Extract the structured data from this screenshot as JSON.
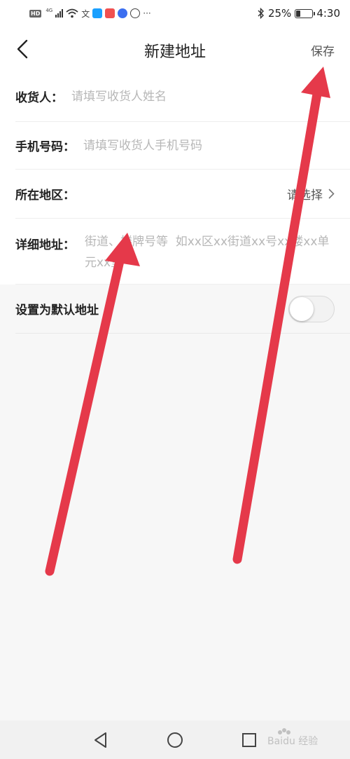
{
  "status_bar": {
    "hd": "HD",
    "network": "4G",
    "battery_text": "25%",
    "battery_level": 0.25,
    "time": "4:30",
    "overflow": "···"
  },
  "header": {
    "title": "新建地址",
    "save_label": "保存"
  },
  "form": {
    "name_label": "收货人：",
    "name_placeholder": "请填写收货人姓名",
    "phone_label": "手机号码：",
    "phone_placeholder": "请填写收货人手机号码",
    "region_label": "所在地区：",
    "region_value": "请选择",
    "detail_label": "详细地址：",
    "detail_placeholder": "街道、楼牌号等  如xx区xx街道xx号xx楼xx单元xx室",
    "default_label": "设置为默认地址",
    "default_on": false
  },
  "colors": {
    "arrow": "#e5394a",
    "background": "#f7f7f7"
  },
  "watermark": {
    "text": "Baidu 经验"
  }
}
